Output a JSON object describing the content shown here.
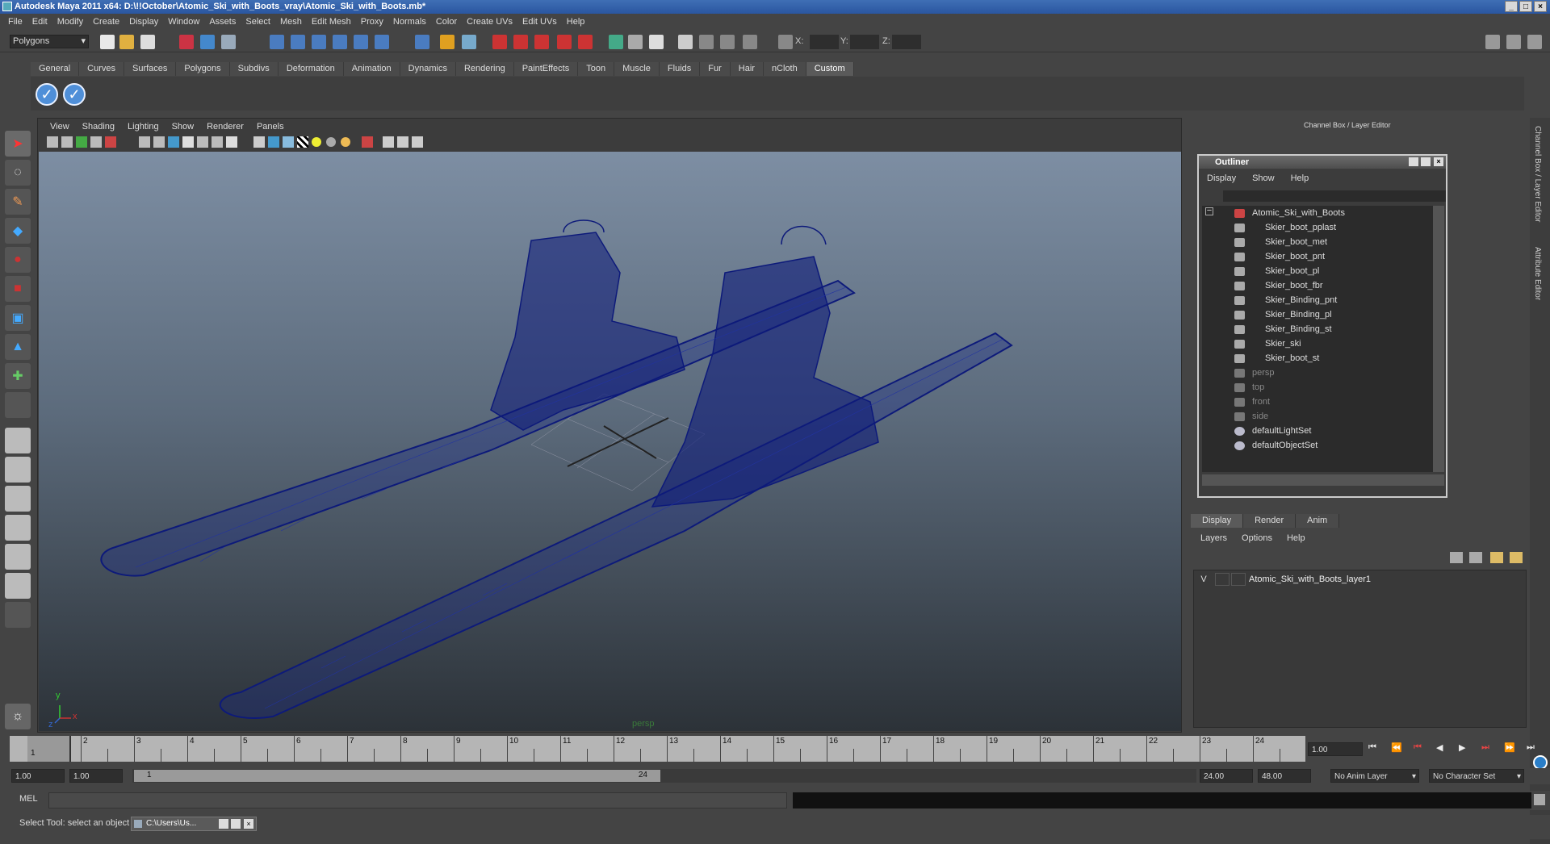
{
  "window": {
    "title": "Autodesk Maya 2011 x64: D:\\!!October\\Atomic_Ski_with_Boots_vray\\Atomic_Ski_with_Boots.mb*",
    "controls": [
      "_",
      "□",
      "×"
    ]
  },
  "menubar": [
    "File",
    "Edit",
    "Modify",
    "Create",
    "Display",
    "Window",
    "Assets",
    "Select",
    "Mesh",
    "Edit Mesh",
    "Proxy",
    "Normals",
    "Color",
    "Create UVs",
    "Edit UVs",
    "Help"
  ],
  "status": {
    "mode": "Polygons",
    "x_label": "X:",
    "y_label": "Y:",
    "z_label": "Z:"
  },
  "shelf": {
    "tabs": [
      "General",
      "Curves",
      "Surfaces",
      "Polygons",
      "Subdivs",
      "Deformation",
      "Animation",
      "Dynamics",
      "Rendering",
      "PaintEffects",
      "Toon",
      "Muscle",
      "Fluids",
      "Fur",
      "Hair",
      "nCloth",
      "Custom"
    ],
    "active_tab": "Custom"
  },
  "viewport": {
    "menu": [
      "View",
      "Shading",
      "Lighting",
      "Show",
      "Renderer",
      "Panels"
    ],
    "camera_label": "persp",
    "axis_y": "y",
    "axis_x": "x",
    "axis_z": "z"
  },
  "channel_box": {
    "header": "Channel Box / Layer Editor",
    "side_tabs": [
      "Channel Box / Layer Editor",
      "Attribute Editor"
    ]
  },
  "outliner": {
    "title": "Outliner",
    "menu": [
      "Display",
      "Show",
      "Help"
    ],
    "root": "Atomic_Ski_with_Boots",
    "children": [
      "Skier_boot_pplast",
      "Skier_boot_met",
      "Skier_boot_pnt",
      "Skier_boot_pl",
      "Skier_boot_fbr",
      "Skier_Binding_pnt",
      "Skier_Binding_pl",
      "Skier_Binding_st",
      "Skier_ski",
      "Skier_boot_st"
    ],
    "cameras": [
      "persp",
      "top",
      "front",
      "side"
    ],
    "sets": [
      "defaultLightSet",
      "defaultObjectSet"
    ]
  },
  "layer_editor": {
    "tabs": [
      "Display",
      "Render",
      "Anim"
    ],
    "active_tab": "Display",
    "menu": [
      "Layers",
      "Options",
      "Help"
    ],
    "layers": [
      {
        "visible": "V",
        "name": "Atomic_Ski_with_Boots_layer1"
      }
    ]
  },
  "timeline": {
    "ticks": [
      "1",
      "2",
      "3",
      "4",
      "5",
      "6",
      "7",
      "8",
      "9",
      "10",
      "11",
      "12",
      "13",
      "14",
      "15",
      "16",
      "17",
      "18",
      "19",
      "20",
      "21",
      "22",
      "23",
      "24"
    ],
    "current_frame_label": "1",
    "current_time": "1.00"
  },
  "range": {
    "start": "1.00",
    "playback_start": "1.00",
    "slider_min": "1",
    "slider_max": "24",
    "playback_end": "24.00",
    "end": "48.00",
    "anim_layer": "No Anim Layer",
    "character_set": "No Character Set"
  },
  "command": {
    "label": "MEL"
  },
  "statusbar": {
    "help": "Select Tool: select an object",
    "taskbar_item": "C:\\Users\\Us..."
  },
  "colors": {
    "wireframe": "#0d1a7a",
    "viewport_top": "#7d8ea3",
    "viewport_bottom": "#2c3238",
    "title_bar": "#2a56a0"
  }
}
